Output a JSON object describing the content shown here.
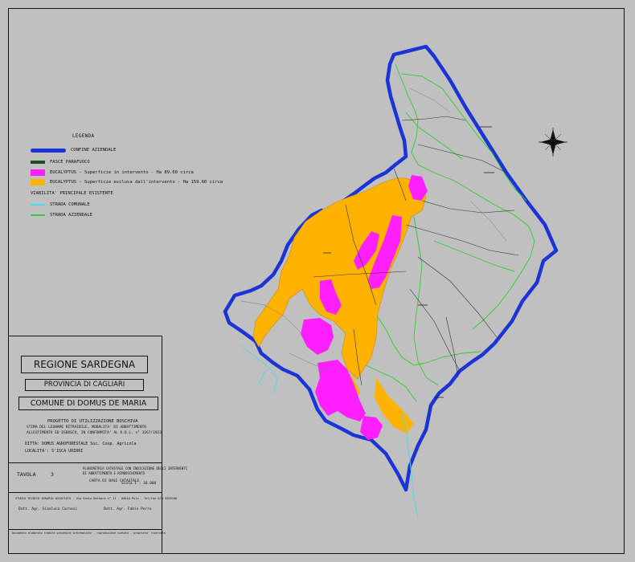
{
  "legend": {
    "heading": "LEGENDA",
    "items": [
      {
        "label": "CONFINE AZIENDALE",
        "color": "#1a34d6",
        "kind": "line-thick"
      },
      {
        "label": "FASCE PARAFUOCO",
        "color": "#1f4d1f",
        "kind": "line-dark"
      },
      {
        "label": "EUCALYPTUS - Superficie in intervento - Ha 89.60 circa",
        "color": "#ff1fff",
        "kind": "fill"
      },
      {
        "label": "EUCALYPTUS - Superficie esclusa dall'intervento - Ha 159.60 circa",
        "color": "#ffb300",
        "kind": "fill"
      }
    ],
    "viability_heading": "VIABILITA' PRINCIPALE ESISTENTE",
    "roads": [
      {
        "label": "STRADA COMUNALE",
        "color": "#4fd9e0"
      },
      {
        "label": "STRADA AZIENDALE",
        "color": "#2ecc2e"
      }
    ]
  },
  "title_block": {
    "region": "REGIONE SARDEGNA",
    "province": "PROVINCIA DI CAGLIARI",
    "comune": "COMUNE DI DOMUS DE MARIA",
    "project": "PROGETTO DI UTILIZZAZIONE BOSCHIVA",
    "project_sub1": "STIMA DEL LEGNAME RITRAIBILE, MODALITA' DI ABBATTIMENTO",
    "project_sub2": "ALLESTIMENTO ED ESBOSCO, IN CONFORMITA' AL R.D.L. n° 3267/1923",
    "ditta": "DITTA: DOMUS AGROFORESTALE Soc. Coop. Agricola",
    "localita": "LOCALITA': S'ISCA URIRRI",
    "tavola_label": "TAVOLA",
    "tavola_num": "3",
    "tavola_desc1": "PLANIMETRIA CATASTALE CON INDICAZIONE DEGLI INTERVENTI",
    "tavola_desc2": "DI ABBATTIMENTO E RIMBOSCHIMENTO",
    "carta": "CARTA DI BASE CATASTALE",
    "scala": "Scala  1 : 10.000",
    "studio": "STUDIO TECNICO AGRARIO ASSOCIATO - Via Santa Barbara n° 11 - 09010 Pula - Tel/fax 070 9209186",
    "signer1": "Dott. Agr. Gianluca Carnesi",
    "signer2": "Dott. Agr. Fabio Porru",
    "footer": "Documento elaborato tramite procedure informatiche - riproduzione vietata - proprieta' riservata"
  }
}
